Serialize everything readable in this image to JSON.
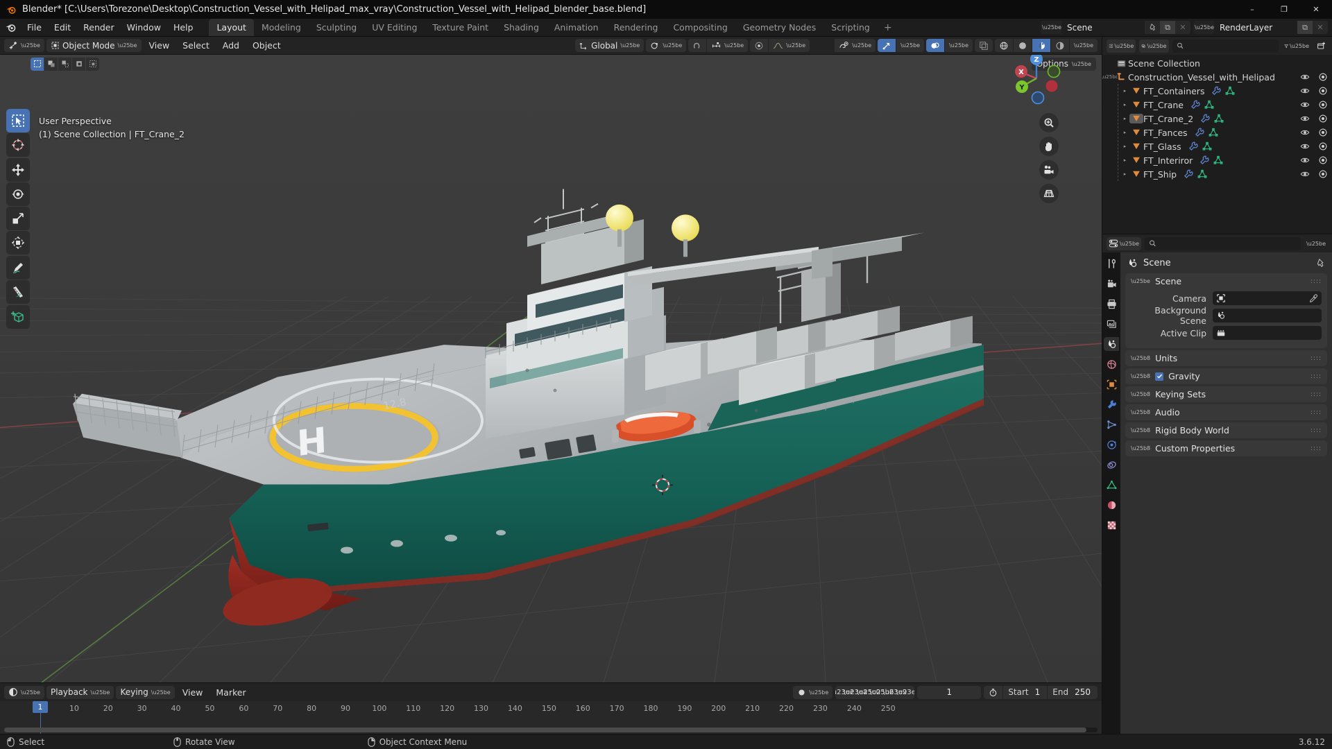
{
  "window": {
    "title": "Blender* [C:\\Users\\Torezone\\Desktop\\Construction_Vessel_with_Helipad_max_vray\\Construction_Vessel_with_Helipad_blender_base.blend]",
    "minimize": "–",
    "maximize": "❐",
    "close": "✕"
  },
  "topbar": {
    "menus": [
      "File",
      "Edit",
      "Render",
      "Window",
      "Help"
    ],
    "workspaces": [
      {
        "label": "Layout",
        "active": true
      },
      {
        "label": "Modeling",
        "active": false
      },
      {
        "label": "Sculpting",
        "active": false
      },
      {
        "label": "UV Editing",
        "active": false
      },
      {
        "label": "Texture Paint",
        "active": false
      },
      {
        "label": "Shading",
        "active": false
      },
      {
        "label": "Animation",
        "active": false
      },
      {
        "label": "Rendering",
        "active": false
      },
      {
        "label": "Compositing",
        "active": false
      },
      {
        "label": "Geometry Nodes",
        "active": false
      },
      {
        "label": "Scripting",
        "active": false
      }
    ],
    "add_workspace": "+",
    "scene": {
      "name": "Scene",
      "new_label": "⧉",
      "remove_label": "✕"
    },
    "view_layer": {
      "name": "RenderLayer",
      "new_label": "⧉",
      "remove_label": "✕"
    }
  },
  "viewport": {
    "mode": "Object Mode",
    "menus": [
      "View",
      "Select",
      "Add",
      "Object"
    ],
    "transform_orientation": "Global",
    "options_label": "Options",
    "overlay_line1": "User Perspective",
    "overlay_line2": "(1) Scene Collection | FT_Crane_2",
    "gizmo_axes": {
      "x": "X",
      "y": "Y",
      "z": "Z"
    },
    "tools": [
      "tweak-select-tool",
      "cursor-tool",
      "move-tool",
      "rotate-tool",
      "scale-tool",
      "transform-tool",
      "annotate-tool",
      "measure-tool",
      "add-cube-tool"
    ],
    "nav_buttons": [
      "zoom-icon",
      "hand-icon",
      "camera-icon",
      "grid-icon"
    ],
    "select_modes": [
      "set-new",
      "extend",
      "subtract",
      "invert",
      "intersect"
    ]
  },
  "outliner": {
    "search_placeholder": "",
    "root": "Scene Collection",
    "collection": "Construction_Vessel_with_Helipad",
    "objects": [
      {
        "name": "FT_Containers",
        "modifier": true,
        "mesh": true
      },
      {
        "name": "FT_Crane",
        "modifier": true,
        "mesh": true
      },
      {
        "name": "FT_Crane_2",
        "modifier": true,
        "mesh": true,
        "active": true
      },
      {
        "name": "FT_Fances",
        "modifier": true,
        "mesh": true
      },
      {
        "name": "FT_Glass",
        "modifier": true,
        "mesh": true
      },
      {
        "name": "FT_Interiror",
        "modifier": true,
        "mesh": true
      },
      {
        "name": "FT_Ship",
        "modifier": true,
        "mesh": true
      }
    ]
  },
  "properties": {
    "search_placeholder": "",
    "header_title": "Scene",
    "tabs": [
      "tool-tab",
      "render-tab",
      "output-tab",
      "view-layer-tab",
      "scene-tab",
      "world-tab",
      "object-tab",
      "modifiers-tab",
      "particles-tab",
      "physics-tab",
      "constraints-tab",
      "data-tab",
      "material-tab",
      "texture-tab"
    ],
    "panels": [
      {
        "label": "Scene",
        "expanded": true
      },
      {
        "label": "Units",
        "expanded": false
      },
      {
        "label": "Gravity",
        "expanded": false,
        "checkbox": true
      },
      {
        "label": "Keying Sets",
        "expanded": false
      },
      {
        "label": "Audio",
        "expanded": false
      },
      {
        "label": "Rigid Body World",
        "expanded": false
      },
      {
        "label": "Custom Properties",
        "expanded": false
      }
    ],
    "scene_fields": [
      {
        "label": "Camera",
        "value": "",
        "icon": "camera-data-icon",
        "eyedropper": true
      },
      {
        "label": "Background Scene",
        "value": "",
        "icon": "scene-icon",
        "eyedropper": false
      },
      {
        "label": "Active Clip",
        "value": "",
        "icon": "clip-icon",
        "eyedropper": false
      }
    ]
  },
  "timeline": {
    "menus": [
      "Playback",
      "Keying",
      "View",
      "Marker"
    ],
    "current_frame": "1",
    "start_label": "Start",
    "start_value": "1",
    "end_label": "End",
    "end_value": "250",
    "ticks": [
      "10",
      "20",
      "30",
      "40",
      "50",
      "60",
      "70",
      "80",
      "90",
      "100",
      "110",
      "120",
      "130",
      "140",
      "150",
      "160",
      "170",
      "180",
      "190",
      "200",
      "210",
      "220",
      "230",
      "240",
      "250"
    ],
    "playhead_label": "1"
  },
  "statusbar": {
    "items": [
      {
        "mouse": "left-mouse-icon",
        "label": "Select"
      },
      {
        "mouse": "middle-mouse-icon",
        "label": "Rotate View"
      },
      {
        "mouse": "right-mouse-icon",
        "label": "Object Context Menu"
      }
    ],
    "version": "3.6.12"
  }
}
